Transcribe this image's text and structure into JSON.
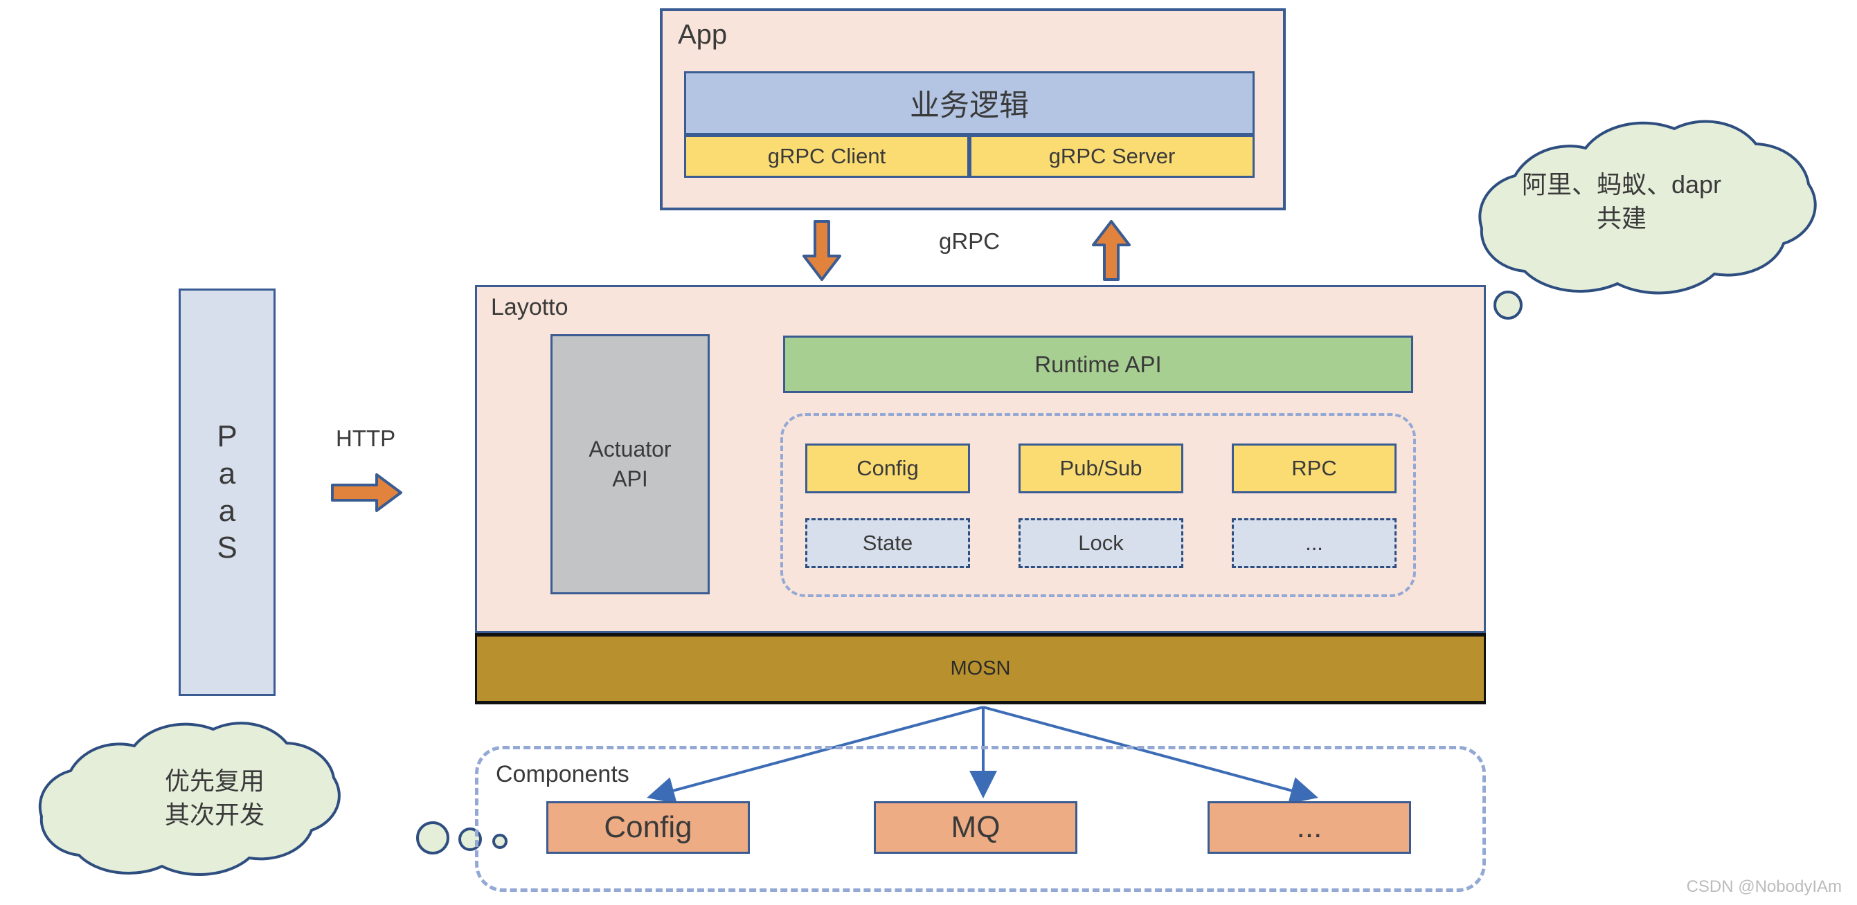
{
  "app": {
    "title": "App",
    "business_logic": "业务逻辑",
    "grpc_client": "gRPC Client",
    "grpc_server": "gRPC Server"
  },
  "connectors": {
    "grpc_label": "gRPC",
    "http_label": "HTTP"
  },
  "paas": {
    "letters": [
      "P",
      "a",
      "a",
      "S"
    ]
  },
  "layotto": {
    "title": "Layotto",
    "actuator_line1": "Actuator",
    "actuator_line2": "API",
    "runtime_api": "Runtime API",
    "apis": [
      {
        "label": "Config",
        "style": "solid"
      },
      {
        "label": "Pub/Sub",
        "style": "solid"
      },
      {
        "label": "RPC",
        "style": "solid"
      },
      {
        "label": "State",
        "style": "dashed"
      },
      {
        "label": "Lock",
        "style": "dashed"
      },
      {
        "label": "...",
        "style": "dashed"
      }
    ],
    "mosn": "MOSN"
  },
  "components": {
    "title": "Components",
    "items": [
      "Config",
      "MQ",
      "..."
    ]
  },
  "clouds": {
    "right_line1": "阿里、蚂蚁、dapr",
    "right_line2": "共建",
    "left_line1": "优先复用",
    "left_line2": "其次开发"
  },
  "watermark": "CSDN @NobodyIAm",
  "colors": {
    "app_fill": "#f8e4da",
    "border_blue": "#3b5c92",
    "business_logic_fill": "#b3c5e3",
    "grpc_fill": "#fadc72",
    "paas_fill": "#d7dfec",
    "actuator_fill": "#c2c4c6",
    "runtime_api_fill": "#a8cf92",
    "dashed_blue": "#93a8d4",
    "mosn_fill": "#b8912e",
    "component_fill": "#edac84",
    "cloud_fill": "#e4eed9",
    "arrow_orange": "#e1833c",
    "arrow_line": "#3b6cb5"
  }
}
